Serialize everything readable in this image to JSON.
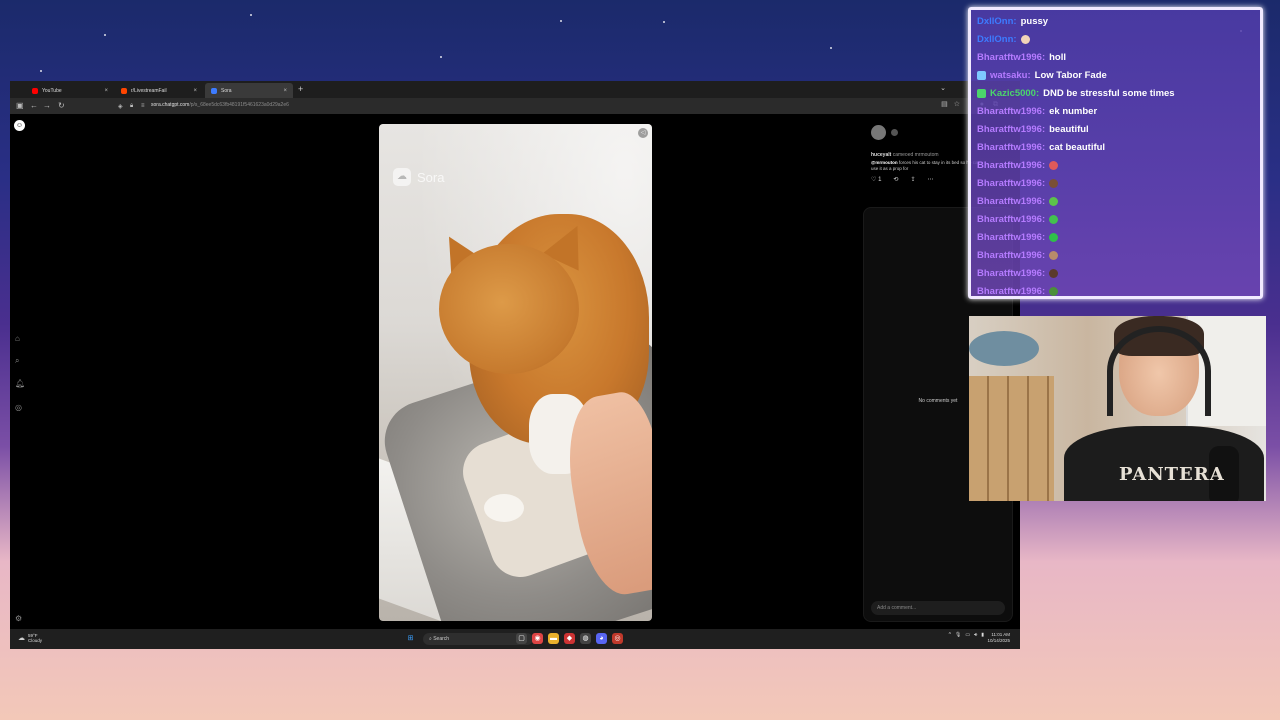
{
  "browser": {
    "tabs": [
      {
        "label": "YouTube",
        "color": "#ff0000",
        "active": false
      },
      {
        "label": "r/LivestreamFail",
        "color": "#ff4500",
        "active": false
      },
      {
        "label": "Sora",
        "color": "#3d7bff",
        "active": true
      }
    ],
    "url_domain": "sora.chatgpt.com",
    "url_path": "/p/s_68ee5dc63fb48191f5461623a0d29a2e6"
  },
  "sora": {
    "watermark": "Sora",
    "post": {
      "username": "huceyalt",
      "action": "cameoed mrmoutom",
      "caption_mention": "@mrmouton",
      "caption": "forces his cat to stay in its bed so he can use it as a prop for",
      "likes": "1"
    },
    "no_comments": "No comments yet",
    "comment_placeholder": "Add a comment..."
  },
  "taskbar": {
    "weather_temp": "59°F",
    "weather_desc": "Cloudy",
    "search_label": "Search",
    "time": "11:01 AM",
    "date": "10/14/2025"
  },
  "chat": {
    "messages": [
      {
        "user": "DxllOnn:",
        "text": "pussy",
        "user_color": "#3d7bff"
      },
      {
        "user": "DxllOnn:",
        "text": "",
        "user_color": "#3d7bff",
        "emote": "#f1d4b8"
      },
      {
        "user": "Bharatftw1996:",
        "text": "holl",
        "user_color": "#b57bff"
      },
      {
        "user": "watsaku:",
        "text": "Low Tabor Fade",
        "user_color": "#b57bff",
        "badge": "#7ec8ff"
      },
      {
        "user": "Kazic5000:",
        "text": "DND be stressful some times",
        "user_color": "#4bd56b",
        "badge": "#4bd56b"
      },
      {
        "user": "Bharatftw1996:",
        "text": "ek number",
        "user_color": "#b57bff"
      },
      {
        "user": "Bharatftw1996:",
        "text": "beautiful",
        "user_color": "#b57bff"
      },
      {
        "user": "Bharatftw1996:",
        "text": "cat beautiful",
        "user_color": "#b57bff"
      },
      {
        "user": "Bharatftw1996:",
        "text": "",
        "user_color": "#b57bff",
        "emote": "#e05a5a"
      },
      {
        "user": "Bharatftw1996:",
        "text": "",
        "user_color": "#b57bff",
        "emote": "#7a4f35"
      },
      {
        "user": "Bharatftw1996:",
        "text": "",
        "user_color": "#b57bff",
        "emote": "#5cc24a"
      },
      {
        "user": "Bharatftw1996:",
        "text": "",
        "user_color": "#b57bff",
        "emote": "#43c04f"
      },
      {
        "user": "Bharatftw1996:",
        "text": "",
        "user_color": "#b57bff",
        "emote": "#2fbf4a"
      },
      {
        "user": "Bharatftw1996:",
        "text": "",
        "user_color": "#b57bff",
        "emote": "#b88b6a"
      },
      {
        "user": "Bharatftw1996:",
        "text": "",
        "user_color": "#b57bff",
        "emote": "#5b3a2b"
      },
      {
        "user": "Bharatftw1996:",
        "text": "",
        "user_color": "#b57bff",
        "emote": "#4b8f3a"
      }
    ]
  },
  "webcam": {
    "shirt_text": "PANTERA"
  }
}
